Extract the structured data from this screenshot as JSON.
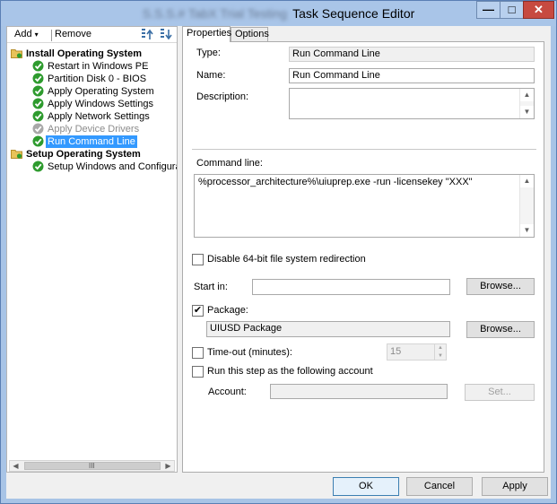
{
  "window": {
    "title_prefix": "S.S.S.# TabX Trial Testing",
    "title": "Task Sequence Editor",
    "minimize_glyph": "—",
    "maximize_glyph": "□",
    "close_glyph": "✕"
  },
  "toolbar": {
    "add_label": "Add",
    "add_arrow": "▾",
    "remove_label": "Remove"
  },
  "tree": {
    "groups": [
      {
        "label": "Install Operating System",
        "icon": "folder-icon",
        "steps": [
          {
            "label": "Restart in Windows PE",
            "status": "ok"
          },
          {
            "label": "Partition Disk 0 - BIOS",
            "status": "ok"
          },
          {
            "label": "Apply Operating System",
            "status": "ok"
          },
          {
            "label": "Apply Windows Settings",
            "status": "ok"
          },
          {
            "label": "Apply Network Settings",
            "status": "ok"
          },
          {
            "label": "Apply Device Drivers",
            "status": "disabled"
          },
          {
            "label": "Run Command Line",
            "status": "ok",
            "selected": true
          }
        ]
      },
      {
        "label": "Setup Operating System",
        "icon": "folder-icon",
        "steps": [
          {
            "label": "Setup Windows and Configuration",
            "status": "ok"
          }
        ]
      }
    ]
  },
  "scroll": {
    "left_glyph": "◀",
    "right_glyph": "▶",
    "grip_glyph": "III",
    "up_glyph": "▲",
    "down_glyph": "▼"
  },
  "tabs": {
    "properties": "Properties",
    "options": "Options"
  },
  "properties": {
    "type_label": "Type:",
    "type_value": "Run Command Line",
    "name_label": "Name:",
    "name_value": "Run Command Line",
    "description_label": "Description:",
    "description_value": "",
    "command_line_label": "Command line:",
    "command_line_value": "%processor_architecture%\\uiuprep.exe -run -licensekey \"XXX\"",
    "disable_redirect_label": "Disable 64-bit file system redirection",
    "disable_redirect_checked": false,
    "start_in_label": "Start in:",
    "start_in_value": "",
    "browse_label": "Browse...",
    "package_label": "Package:",
    "package_checked": true,
    "package_value": "UIUSD Package",
    "timeout_label": "Time-out (minutes):",
    "timeout_checked": false,
    "timeout_value": "15",
    "run_as_label": "Run this step as the following account",
    "run_as_checked": false,
    "account_label": "Account:",
    "account_value": "",
    "set_label": "Set...",
    "check_glyph": "✔"
  },
  "buttons": {
    "ok": "OK",
    "cancel": "Cancel",
    "apply": "Apply"
  },
  "colors": {
    "selection": "#3399ff",
    "ok_check": "#2e9b2e",
    "folder": "#e8c35a"
  }
}
